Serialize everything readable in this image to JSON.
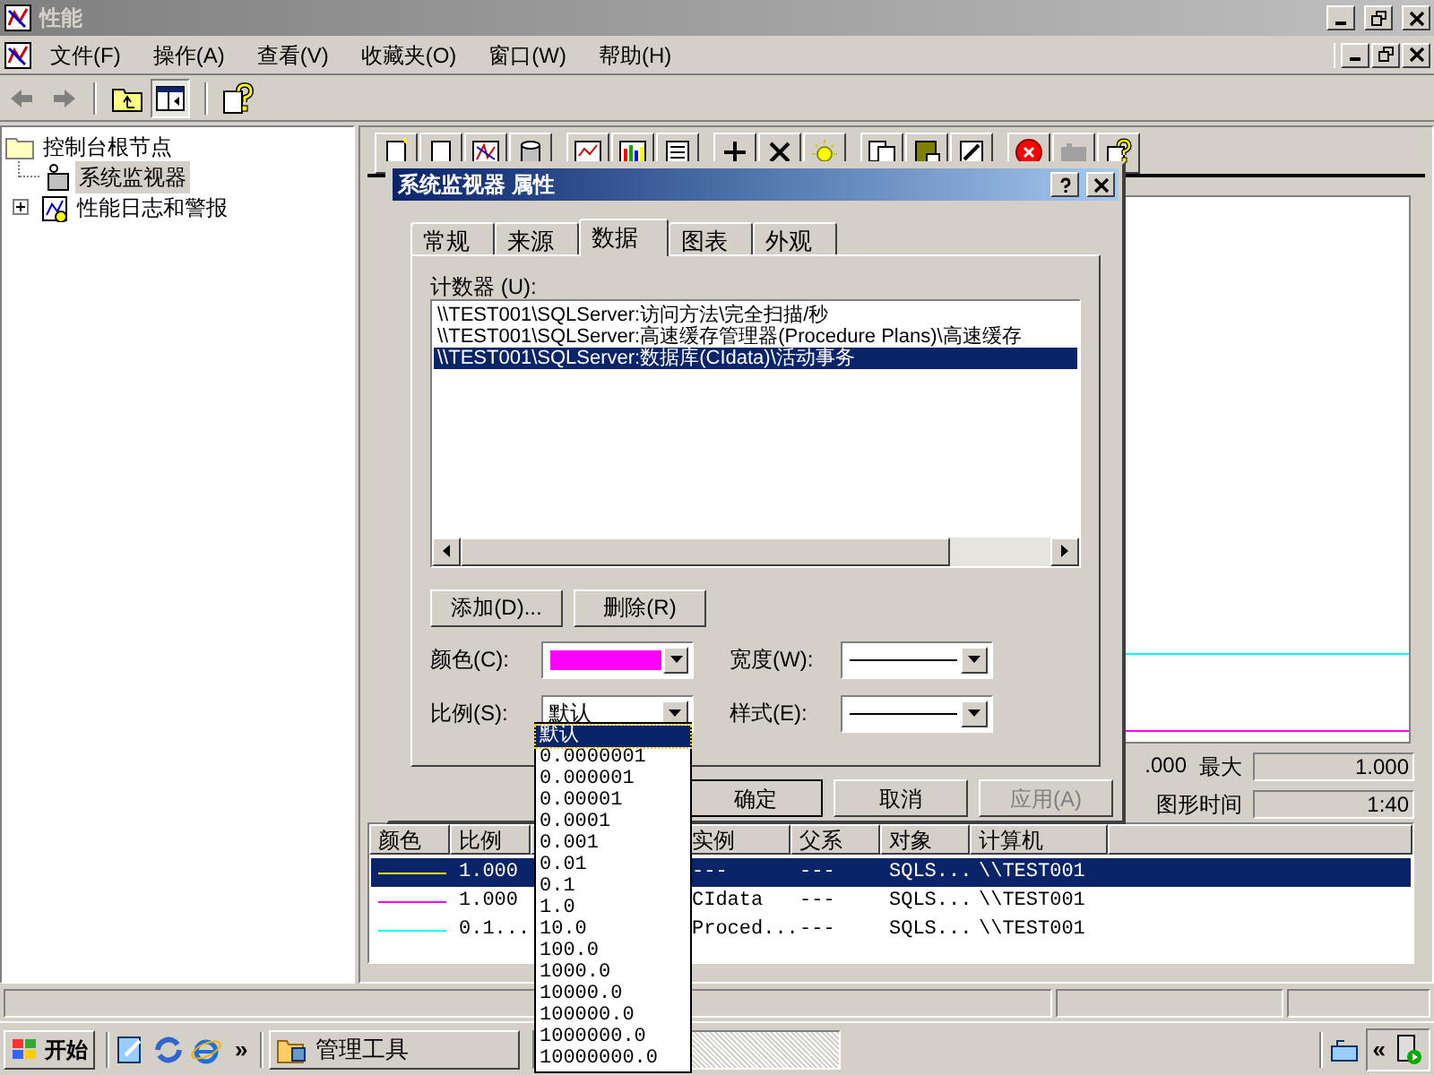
{
  "window": {
    "title": "性能"
  },
  "menu": [
    "文件(F)",
    "操作(A)",
    "查看(V)",
    "收藏夹(O)",
    "窗口(W)",
    "帮助(H)"
  ],
  "tree": [
    {
      "label": "控制台根节点",
      "selected": false,
      "children": [
        {
          "label": "系统监视器",
          "selected": true
        },
        {
          "label": "性能日志和警报",
          "selected": false,
          "expanded": false
        }
      ]
    }
  ],
  "values_bar": {
    "minimum_value": ".000",
    "maximum_label": "最大",
    "maximum_value": "1.000",
    "duration_label": "图形时间",
    "duration_value": "1:40"
  },
  "counter_table": {
    "columns": [
      "颜色",
      "比例",
      "实例",
      "父系",
      "对象",
      "计算机"
    ],
    "rows": [
      {
        "color": "#ffff00",
        "scale": "1.000",
        "instance": "---",
        "parent": "---",
        "object": "SQLS...",
        "computer": "\\\\TEST001",
        "selected": true
      },
      {
        "color": "#ff00ff",
        "scale": "1.000",
        "instance": "CIdata",
        "parent": "---",
        "object": "SQLS...",
        "computer": "\\\\TEST001",
        "selected": false
      },
      {
        "color": "#00ffff",
        "scale": "0.1...",
        "instance": "Proced...",
        "parent": "---",
        "object": "SQLS...",
        "computer": "\\\\TEST001",
        "selected": false
      }
    ]
  },
  "dialog": {
    "title": "系统监视器 属性",
    "tabs": [
      {
        "label": "常规",
        "selected": false
      },
      {
        "label": "来源",
        "selected": false
      },
      {
        "label": "数据",
        "selected": true
      },
      {
        "label": "图表",
        "selected": false
      },
      {
        "label": "外观",
        "selected": false
      }
    ],
    "counters_label": "计数器 (U):",
    "counters": [
      {
        "text": "\\\\TEST001\\SQLServer:访问方法\\完全扫描/秒",
        "selected": false
      },
      {
        "text": "\\\\TEST001\\SQLServer:高速缓存管理器(Procedure Plans)\\高速缓存",
        "selected": false
      },
      {
        "text": "\\\\TEST001\\SQLServer:数据库(CIdata)\\活动事务",
        "selected": true
      }
    ],
    "add_button": "添加(D)...",
    "remove_button": "删除(R)",
    "color_label": "颜色(C):",
    "color": "#ff00ff",
    "width_label": "宽度(W):",
    "scale_label": "比例(S):",
    "scale_value": "默认",
    "style_label": "样式(E):",
    "buttons": [
      {
        "label": "确定",
        "disabled": false
      },
      {
        "label": "取消",
        "disabled": false
      },
      {
        "label": "应用(A)",
        "disabled": true
      }
    ]
  },
  "scale_dropdown": {
    "options": [
      {
        "label": "默认",
        "selected": true
      },
      {
        "label": "0.0000001",
        "selected": false
      },
      {
        "label": "0.000001",
        "selected": false
      },
      {
        "label": "0.00001",
        "selected": false
      },
      {
        "label": "0.0001",
        "selected": false
      },
      {
        "label": "0.001",
        "selected": false
      },
      {
        "label": "0.01",
        "selected": false
      },
      {
        "label": "0.1",
        "selected": false
      },
      {
        "label": "1.0",
        "selected": false
      },
      {
        "label": "10.0",
        "selected": false
      },
      {
        "label": "100.0",
        "selected": false
      },
      {
        "label": "1000.0",
        "selected": false
      },
      {
        "label": "10000.0",
        "selected": false
      },
      {
        "label": "100000.0",
        "selected": false
      },
      {
        "label": "1000000.0",
        "selected": false
      },
      {
        "label": "10000000.0",
        "selected": false
      }
    ]
  },
  "taskbar": {
    "start": "开始",
    "more": "»",
    "task": "管理工具",
    "tray_toggle": "«"
  }
}
